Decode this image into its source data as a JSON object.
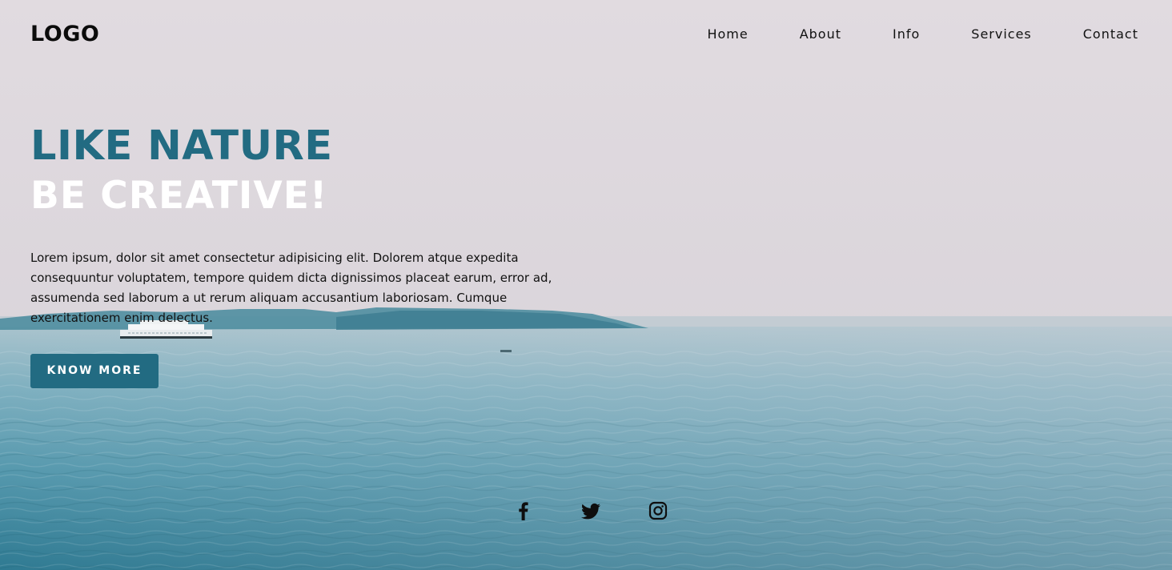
{
  "header": {
    "logo": "LOGO",
    "nav": [
      {
        "label": "Home"
      },
      {
        "label": "About"
      },
      {
        "label": "Info"
      },
      {
        "label": "Services"
      },
      {
        "label": "Contact"
      }
    ]
  },
  "hero": {
    "title_line_1": "LIKE NATURE",
    "title_line_2": "BE CREATIVE!",
    "body": "Lorem ipsum, dolor sit amet consectetur adipisicing elit. Dolorem atque expedita consequuntur voluptatem, tempore quidem dicta dignissimos placeat earum, error ad, assumenda sed laborum a ut rerum aliquam accusantium laboriosam. Cumque exercitationem enim delectus.",
    "button_label": "KNOW MORE"
  },
  "social": [
    {
      "icon": "facebook-icon"
    },
    {
      "icon": "twitter-icon"
    },
    {
      "icon": "instagram-icon"
    }
  ],
  "colors": {
    "accent": "#226b82",
    "sky": "#dcd6dc",
    "water": "#3a8aa3",
    "text": "#111111"
  }
}
